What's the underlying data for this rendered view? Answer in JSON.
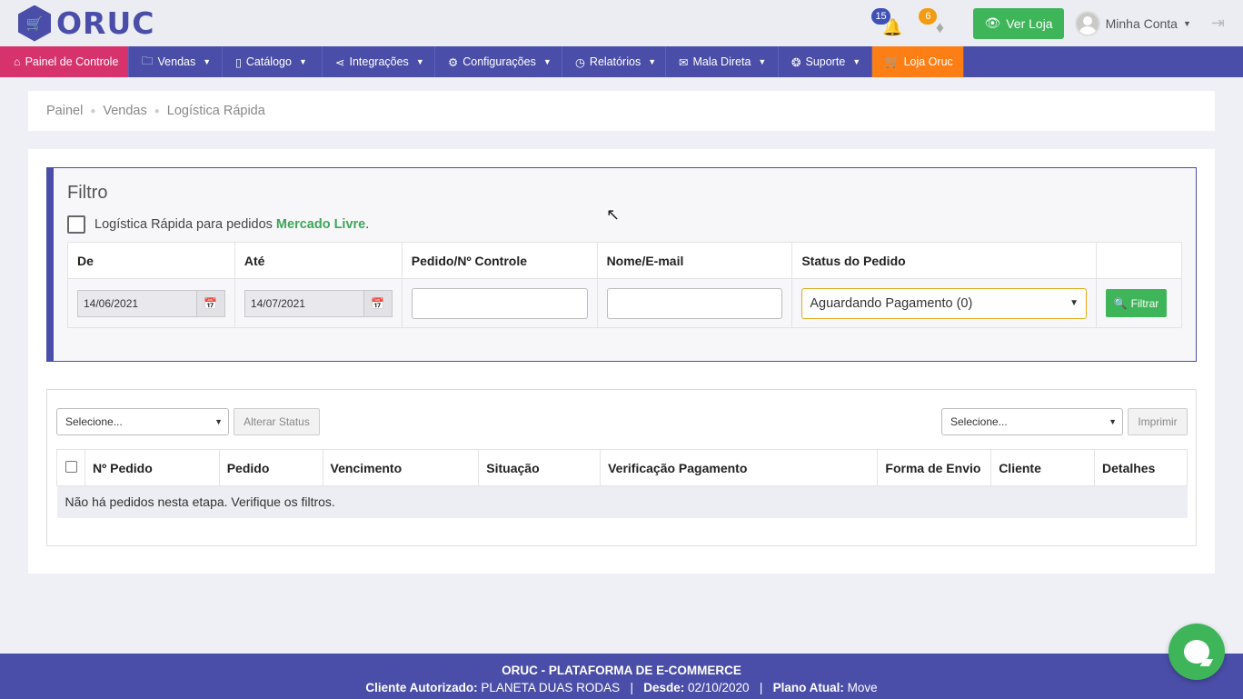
{
  "brand": {
    "logo_text": "ORUC",
    "logo_icon": "cart-icon",
    "color": "#4a4ea8"
  },
  "header": {
    "notifications_count": "15",
    "messages_count": "6",
    "view_store_label": "Ver Loja",
    "account_label": "Minha Conta"
  },
  "nav": {
    "items": [
      {
        "label": "Painel de Controle",
        "icon": "home-icon"
      },
      {
        "label": "Vendas",
        "icon": "folder-icon"
      },
      {
        "label": "Catálogo",
        "icon": "book-icon"
      },
      {
        "label": "Integrações",
        "icon": "share-icon"
      },
      {
        "label": "Configurações",
        "icon": "gear-icon"
      },
      {
        "label": "Relatórios",
        "icon": "chart-icon"
      },
      {
        "label": "Mala Direta",
        "icon": "mail-icon"
      },
      {
        "label": "Suporte",
        "icon": "lifebuoy-icon"
      },
      {
        "label": "Loja Oruc",
        "icon": "cart-icon"
      }
    ],
    "active_color": "#d6336c",
    "store_color": "#fd7e14"
  },
  "breadcrumb": {
    "items": [
      "Painel",
      "Vendas",
      "Logística Rápida"
    ]
  },
  "filter": {
    "title": "Filtro",
    "ml_label": "Logística Rápida para pedidos ",
    "ml_brand": "Mercado Livre",
    "ml_suffix": ".",
    "columns": {
      "from": "De",
      "to": "Até",
      "order": "Pedido/Nº Controle",
      "name": "Nome/E-mail",
      "status": "Status do Pedido"
    },
    "from_value": "14/06/2021",
    "to_value": "14/07/2021",
    "status_value": "Aguardando Pagamento (0)",
    "filter_button": "Filtrar"
  },
  "orders": {
    "select_left": "Selecione...",
    "change_status_button": "Alterar Status",
    "select_right": "Selecione...",
    "print_button": "Imprimir",
    "columns": [
      "Nº Pedido",
      "Pedido",
      "Vencimento",
      "Situação",
      "Verificação Pagamento",
      "Forma de Envio",
      "Cliente",
      "Detalhes"
    ],
    "empty_message": "Não há pedidos nesta etapa. Verifique os filtros."
  },
  "footer": {
    "title": "ORUC - PLATAFORMA DE E-COMMERCE",
    "client_label": "Cliente Autorizado:",
    "client_value": "PLANETA DUAS RODAS",
    "since_label": "Desde:",
    "since_value": "02/10/2020",
    "plan_label": "Plano Atual:",
    "plan_value": "Move"
  }
}
